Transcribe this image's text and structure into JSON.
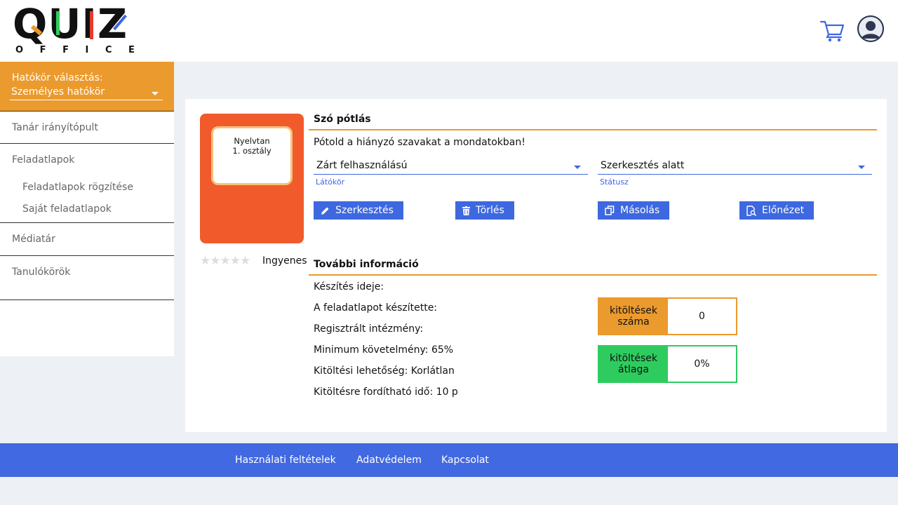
{
  "header": {
    "logo_top": [
      "Q",
      "U",
      "I",
      "Z"
    ],
    "logo_bottom": [
      "O",
      "F",
      "F",
      "I",
      "C",
      "E"
    ],
    "colors": {
      "accent_orange": "#eb9a2d",
      "brand_blue": "#4169e1",
      "success_green": "#2ecc5f",
      "thumb_red": "#f15a2b"
    },
    "icons": {
      "cart": "cart-icon",
      "user": "avatar"
    }
  },
  "sidebar": {
    "scope_label": "Hatókör választás:",
    "scope_value": "Személyes hatókör",
    "items": {
      "teacher_dashboard": "Tanár irányítópult",
      "worksheets": "Feladatlapok",
      "worksheets_record": "Feladatlapok rögzítése",
      "own_worksheets": "Saját feladatlapok",
      "media_library": "Médiatár",
      "study_groups": "Tanulókörök"
    }
  },
  "worksheet": {
    "thumb_line1": "Nyelvtan",
    "thumb_line2": "1. osztály",
    "rating_stars": 0,
    "rating_max": 5,
    "price": "Ingyenes",
    "title": "Szó pótlás",
    "description": "Pótold a hiányzó szavakat a mondatokban!",
    "visibility": {
      "value": "Zárt felhasználású",
      "label": "Látókör"
    },
    "status": {
      "value": "Szerkesztés alatt",
      "label": "Státusz"
    },
    "buttons": {
      "edit": "Szerkesztés",
      "delete": "Törlés",
      "copy": "Másolás",
      "preview": "Előnézet"
    }
  },
  "info": {
    "title": "További információ",
    "created": "Készítés ideje:",
    "author": "A feladatlapot készítette:",
    "institution": "Regisztrált intézmény:",
    "min_requirement": "Minimum követelmény: 65%",
    "attempts": "Kitöltési lehetőség: Korlátlan",
    "time_limit": "Kitöltésre fordítható idő: 10 p",
    "stats": {
      "count_label": "kitöltések száma",
      "count_value": "0",
      "avg_label": "kitöltések átlaga",
      "avg_value": "0%"
    }
  },
  "footer": {
    "terms": "Használati feltételek",
    "privacy": "Adatvédelem",
    "contact": "Kapcsolat"
  }
}
